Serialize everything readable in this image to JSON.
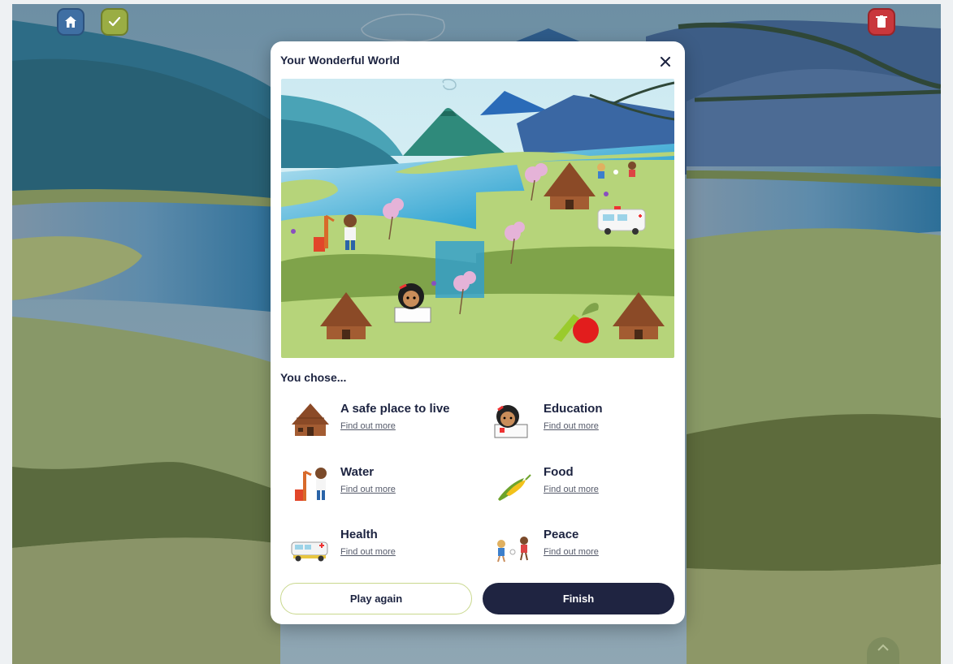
{
  "modal": {
    "title": "Your Wonderful World",
    "chose_label": "You chose...",
    "choices": [
      {
        "name": "A safe place to live",
        "link": "Find out more",
        "icon": "hut-icon"
      },
      {
        "name": "Education",
        "link": "Find out more",
        "icon": "reading-child-icon"
      },
      {
        "name": "Water",
        "link": "Find out more",
        "icon": "water-pump-icon"
      },
      {
        "name": "Food",
        "link": "Find out more",
        "icon": "corn-icon"
      },
      {
        "name": "Health",
        "link": "Find out more",
        "icon": "ambulance-icon"
      },
      {
        "name": "Peace",
        "link": "Find out more",
        "icon": "playing-children-icon"
      }
    ],
    "buttons": {
      "play_again": "Play again",
      "finish": "Finish"
    }
  },
  "toolbar": {
    "home_icon": "home-icon",
    "check_icon": "check-icon",
    "trash_icon": "trash-icon"
  },
  "colors": {
    "navy": "#1f2441",
    "home": "#3f6fa3",
    "check": "#9aad44",
    "trash": "#c9373c",
    "accent_border": "#c9d88e"
  }
}
